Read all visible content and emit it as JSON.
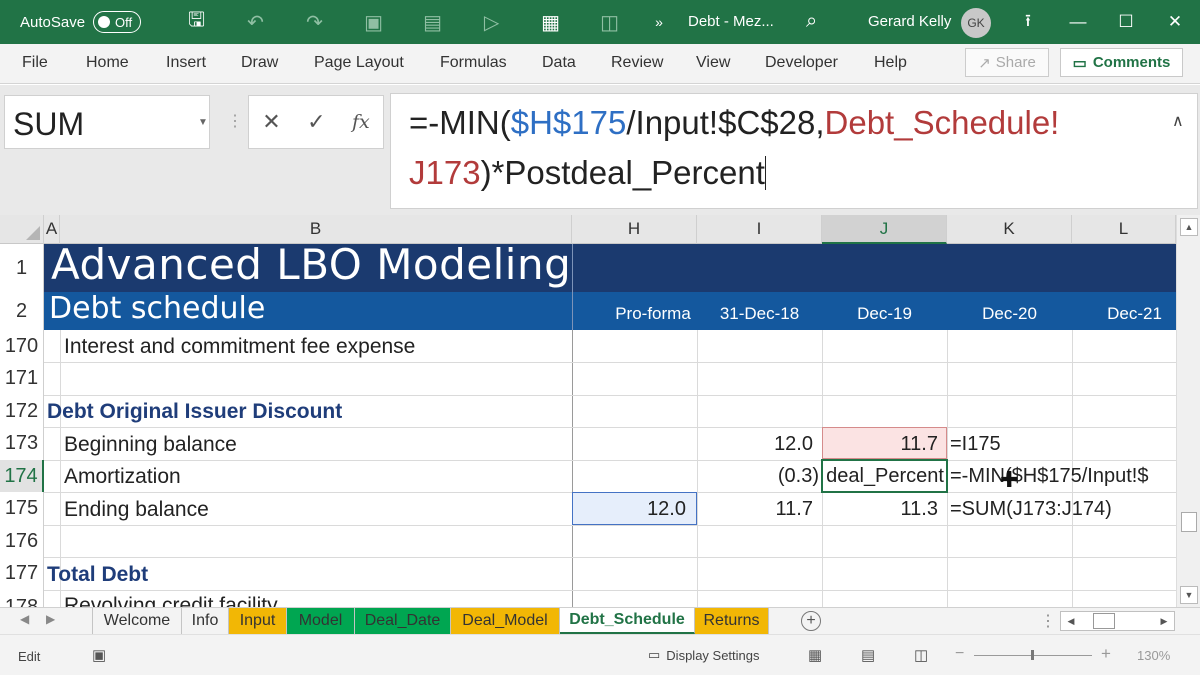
{
  "titlebar": {
    "autosave_label": "AutoSave",
    "autosave_state": "Off",
    "document_title": "Debt - Mez...",
    "user_name": "Gerard Kelly",
    "user_initials": "GK",
    "overflow": "»"
  },
  "ribbon": {
    "tabs": [
      "File",
      "Home",
      "Insert",
      "Draw",
      "Page Layout",
      "Formulas",
      "Data",
      "Review",
      "View",
      "Developer",
      "Help"
    ],
    "share_label": "Share",
    "comments_label": "Comments"
  },
  "formula_bar": {
    "name_box": "SUM",
    "formula_line1_a": "=-MIN(",
    "formula_line1_b": "$H$175",
    "formula_line1_c": "/Input!$C$28,",
    "formula_line1_d": "Debt_Schedule!",
    "formula_line2_a": "J173",
    "formula_line2_b": ")*Postdeal_Percent"
  },
  "sheet": {
    "columns": [
      "A",
      "B",
      "H",
      "I",
      "J",
      "K",
      "L"
    ],
    "title": "Advanced LBO Modeling",
    "subtitle": "Debt schedule",
    "date_headers": [
      "Pro-forma",
      "31-Dec-18",
      "Dec-19",
      "Dec-20",
      "Dec-21"
    ],
    "row_numbers": [
      "1",
      "2",
      "170",
      "171",
      "172",
      "173",
      "174",
      "175",
      "176",
      "177",
      "178"
    ],
    "rows": {
      "r170": "Interest and commitment fee expense",
      "r172": "Debt Original Issuer Discount",
      "r173": "Beginning balance",
      "r174": "Amortization",
      "r175": "Ending balance",
      "r177": "Total Debt",
      "r178": "Revolving credit facility"
    },
    "values": {
      "i173": "12.0",
      "j173": "11.7",
      "k173": "=I175",
      "i174": "(0.3)",
      "j174": "deal_Percent",
      "k174": "=-MIN($H$175/Input!$",
      "h175": "12.0",
      "i175": "11.7",
      "j175": "11.3",
      "k175": "=SUM(J173:J174)"
    }
  },
  "sheet_tabs": [
    {
      "label": "Welcome",
      "color": "#f3f3f3"
    },
    {
      "label": "Info",
      "color": "#f3f3f3"
    },
    {
      "label": "Input",
      "color": "#f2b705"
    },
    {
      "label": "Model",
      "color": "#00a651"
    },
    {
      "label": "Deal_Date",
      "color": "#00a651"
    },
    {
      "label": "Deal_Model",
      "color": "#f2b705"
    },
    {
      "label": "Debt_Schedule",
      "color": "#ffffff"
    },
    {
      "label": "Returns",
      "color": "#f2b705"
    }
  ],
  "statusbar": {
    "mode": "Edit",
    "display_settings": "Display Settings",
    "zoom": "130%"
  },
  "colors": {
    "excel_green": "#217346",
    "title_band": "#1b3a6f",
    "subtitle_band": "#14589e",
    "section_text": "#1f3d7a"
  }
}
